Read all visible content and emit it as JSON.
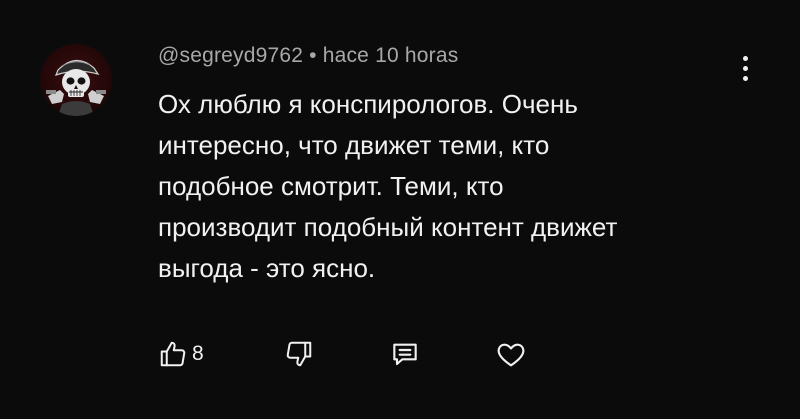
{
  "comment": {
    "author": "@segreyd9762",
    "separator": "•",
    "timestamp": "hace 10 horas",
    "text_lines": [
      "Ох люблю я конспирологов. Очень",
      "интересно, что движет теми, кто",
      "подобное смотрит. Теми, кто",
      "производит подобный контент движет",
      "выгода - это ясно."
    ],
    "like_count": "8"
  },
  "icons": {
    "avatar": "skull-avatar-icon",
    "more": "more-vertical-icon",
    "like": "thumbs-up-icon",
    "dislike": "thumbs-down-icon",
    "reply": "reply-comment-icon",
    "heart": "heart-icon"
  },
  "colors": {
    "background": "#0b0b0b",
    "text": "#f1f1f1",
    "meta_text": "#a8a8a8"
  }
}
